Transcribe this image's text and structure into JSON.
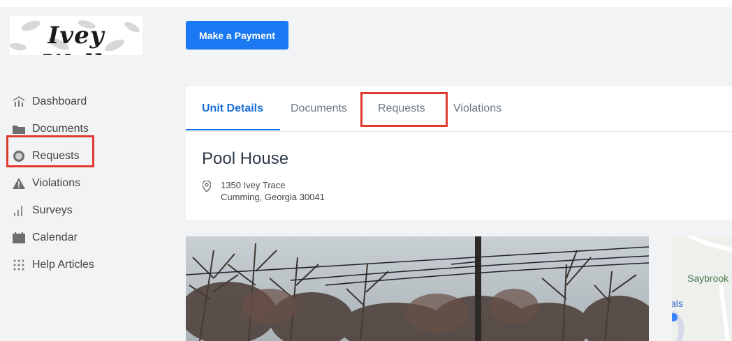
{
  "logo": {
    "text": "Ivey Walk"
  },
  "header": {
    "make_payment_label": "Make a Payment"
  },
  "sidebar": {
    "items": [
      {
        "label": "Dashboard",
        "icon": "chart-bars-icon"
      },
      {
        "label": "Documents",
        "icon": "folder-icon"
      },
      {
        "label": "Requests",
        "icon": "circle-icon"
      },
      {
        "label": "Violations",
        "icon": "warning-triangle-icon"
      },
      {
        "label": "Surveys",
        "icon": "bar-chart-icon"
      },
      {
        "label": "Calendar",
        "icon": "calendar-icon"
      },
      {
        "label": "Help Articles",
        "icon": "grid-dots-icon"
      }
    ]
  },
  "tabs": [
    {
      "label": "Unit Details"
    },
    {
      "label": "Documents"
    },
    {
      "label": "Requests"
    },
    {
      "label": "Violations"
    }
  ],
  "unit": {
    "title": "Pool House",
    "address_line1": "1350 Ivey Trace",
    "address_line2": "Cumming, Georgia 30041"
  },
  "map": {
    "label_saybrook": "Saybrook",
    "label_partial": "als"
  },
  "colors": {
    "accent": "#1978f2",
    "highlight": "#e03a2f"
  }
}
